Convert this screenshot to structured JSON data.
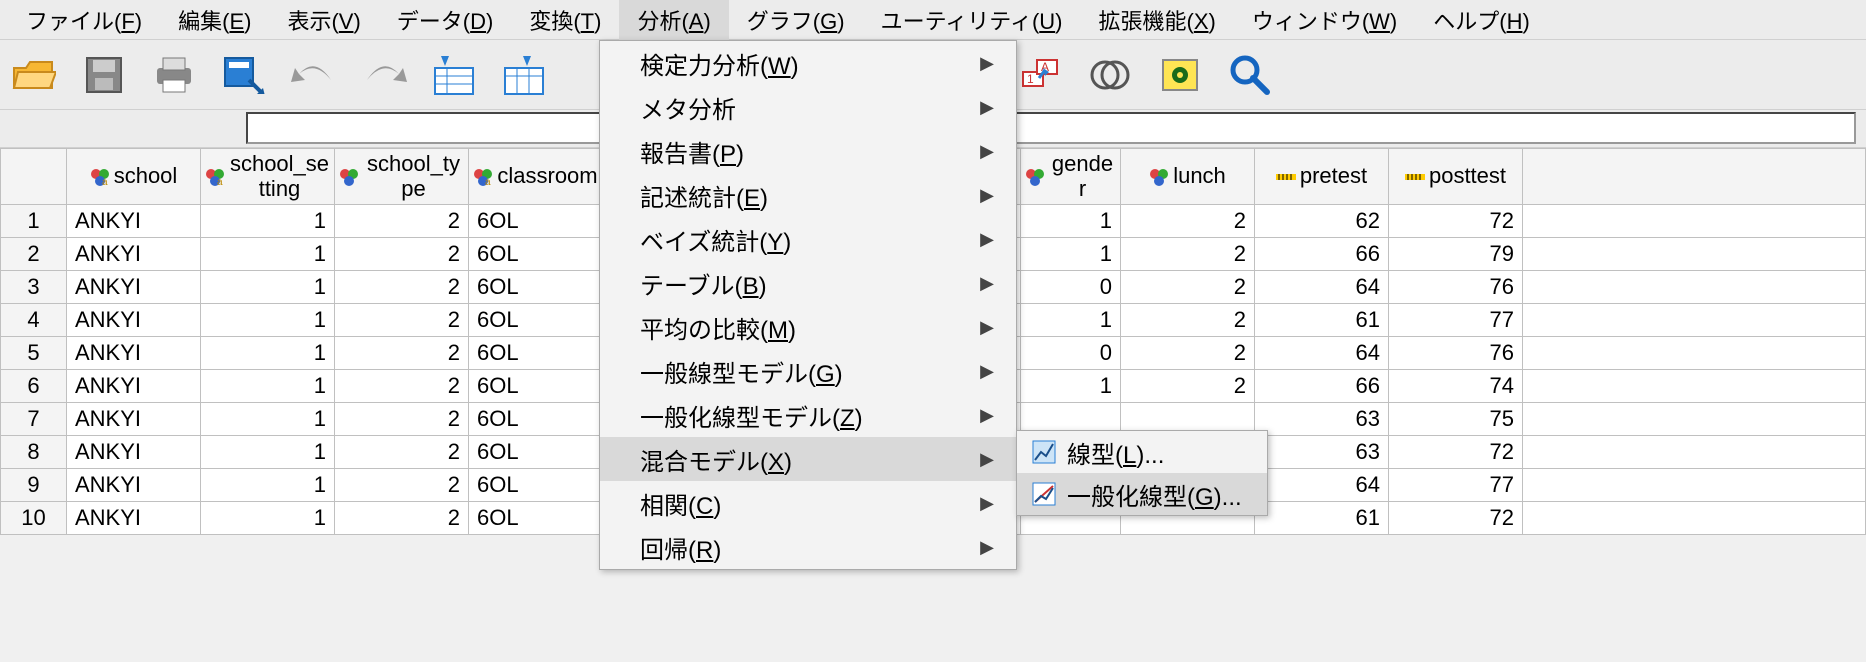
{
  "menubar": [
    {
      "label": "ファイル",
      "key": "F"
    },
    {
      "label": "編集",
      "key": "E"
    },
    {
      "label": "表示",
      "key": "V"
    },
    {
      "label": "データ",
      "key": "D"
    },
    {
      "label": "変換",
      "key": "T"
    },
    {
      "label": "分析",
      "key": "A",
      "highlight": true
    },
    {
      "label": "グラフ",
      "key": "G"
    },
    {
      "label": "ユーティリティ",
      "key": "U"
    },
    {
      "label": "拡張機能",
      "key": "X"
    },
    {
      "label": "ウィンドウ",
      "key": "W"
    },
    {
      "label": "ヘルプ",
      "key": "H"
    }
  ],
  "dropdown": [
    {
      "label": "検定力分析",
      "key": "W",
      "sub": true
    },
    {
      "label": "メタ分析",
      "key": "",
      "sub": true
    },
    {
      "label": "報告書",
      "key": "P",
      "sub": true
    },
    {
      "label": "記述統計",
      "key": "E",
      "sub": true
    },
    {
      "label": "ベイズ統計",
      "key": "Y",
      "sub": true
    },
    {
      "label": "テーブル",
      "key": "B",
      "sub": true
    },
    {
      "label": "平均の比較",
      "key": "M",
      "sub": true
    },
    {
      "label": "一般線型モデル",
      "key": "G",
      "sub": true
    },
    {
      "label": "一般化線型モデル",
      "key": "Z",
      "sub": true
    },
    {
      "label": "混合モデル",
      "key": "X",
      "sub": true,
      "hover": true
    },
    {
      "label": "相関",
      "key": "C",
      "sub": true
    },
    {
      "label": "回帰",
      "key": "R",
      "sub": true
    }
  ],
  "submenu": [
    {
      "label": "線型",
      "key": "L",
      "trail": "...",
      "icon": "linear"
    },
    {
      "label": "一般化線型",
      "key": "G",
      "trail": "...",
      "icon": "genlinear",
      "hover": true
    }
  ],
  "columns": {
    "school": "school",
    "school_setting": "school_setting",
    "school_type": "school_type",
    "classroom": "classroom",
    "gender": "gender",
    "lunch": "lunch",
    "pretest": "pretest",
    "posttest": "posttest"
  },
  "rows": [
    {
      "n": 1,
      "school": "ANKYI",
      "setting": 1,
      "type": 2,
      "classroom": "6OL",
      "gender": 1,
      "lunch": 2,
      "pretest": 62,
      "posttest": 72
    },
    {
      "n": 2,
      "school": "ANKYI",
      "setting": 1,
      "type": 2,
      "classroom": "6OL",
      "gender": 1,
      "lunch": 2,
      "pretest": 66,
      "posttest": 79
    },
    {
      "n": 3,
      "school": "ANKYI",
      "setting": 1,
      "type": 2,
      "classroom": "6OL",
      "gender": 0,
      "lunch": 2,
      "pretest": 64,
      "posttest": 76
    },
    {
      "n": 4,
      "school": "ANKYI",
      "setting": 1,
      "type": 2,
      "classroom": "6OL",
      "gender": 1,
      "lunch": 2,
      "pretest": 61,
      "posttest": 77
    },
    {
      "n": 5,
      "school": "ANKYI",
      "setting": 1,
      "type": 2,
      "classroom": "6OL",
      "gender": 0,
      "lunch": 2,
      "pretest": 64,
      "posttest": 76
    },
    {
      "n": 6,
      "school": "ANKYI",
      "setting": 1,
      "type": 2,
      "classroom": "6OL",
      "gender": 1,
      "lunch": 2,
      "pretest": 66,
      "posttest": 74
    },
    {
      "n": 7,
      "school": "ANKYI",
      "setting": 1,
      "type": 2,
      "classroom": "6OL",
      "gender": "",
      "lunch": "",
      "pretest": 63,
      "posttest": 75
    },
    {
      "n": 8,
      "school": "ANKYI",
      "setting": 1,
      "type": 2,
      "classroom": "6OL",
      "gender": "",
      "lunch": "",
      "pretest": 63,
      "posttest": 72
    },
    {
      "n": 9,
      "school": "ANKYI",
      "setting": 1,
      "type": 2,
      "classroom": "6OL",
      "gender": "",
      "lunch": "",
      "pretest": 64,
      "posttest": 77
    },
    {
      "n": 10,
      "school": "ANKYI",
      "setting": 1,
      "type": 2,
      "classroom": "6OL",
      "gender": "",
      "lunch": "",
      "pretest": 61,
      "posttest": 72
    }
  ]
}
